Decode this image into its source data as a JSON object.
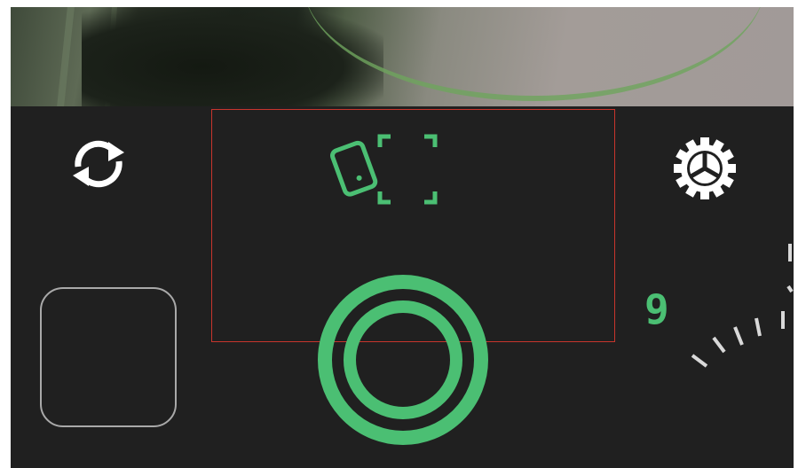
{
  "colors": {
    "accent": "#4bbf73",
    "background": "#202020",
    "icon_white": "#ffffff",
    "highlight": "#c8352c",
    "thumb_border": "#a9a9a9"
  },
  "top_bar": {
    "left_icon": "sync-icon",
    "center_icon": "rotate-device-crop-icon",
    "right_icon": "gear-icon"
  },
  "controls": {
    "gallery_icon": "gallery-thumbnail",
    "shutter_icon": "shutter-button",
    "zoom_value": "9"
  }
}
